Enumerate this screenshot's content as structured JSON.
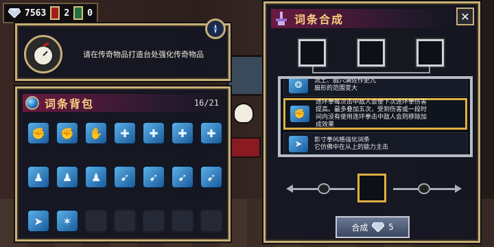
{
  "hud": {
    "gems": "7563",
    "red_cards": "2",
    "green_cards": "0"
  },
  "quest": {
    "text": "请在传奇物品打造台处强化传奇物品"
  },
  "bag": {
    "title": "词条背包",
    "count": "16/21",
    "slots": [
      {
        "icon": "bunny-fist-icon"
      },
      {
        "icon": "bunny-fist-icon"
      },
      {
        "icon": "gauntlet-icon"
      },
      {
        "icon": "fist-plus-icon"
      },
      {
        "icon": "fist-plus-icon"
      },
      {
        "icon": "fist-plus-icon"
      },
      {
        "icon": "fist-plus-icon"
      },
      {
        "icon": "figure-icon"
      },
      {
        "icon": "figure-icon"
      },
      {
        "icon": "figure-icon"
      },
      {
        "icon": "kick-icon"
      },
      {
        "icon": "kick-icon"
      },
      {
        "icon": "kick-icon"
      },
      {
        "icon": "kick-icon"
      },
      {
        "icon": "dash-icon"
      },
      {
        "icon": "break-icon"
      }
    ]
  },
  "synth": {
    "title": "词条合成",
    "affixes": [
      {
        "text": "流土、戲穴满佐作吏亢\n扇形的范围变大",
        "icon": "fan-icon"
      },
      {
        "text": "连环拳每次击中敌人会使下次连环拳伤害\n提高。最多叠加五次，受到伤害或一段时\n间内没有使用连环拳击中敌人会则移除加\n成效果",
        "icon": "bunny-fist-icon"
      },
      {
        "text": "影寸拳风格强化词条\n它仿佛中在从上的能力主击",
        "icon": "dash-icon"
      }
    ],
    "button_label": "合成",
    "cost": "5"
  },
  "colors": {
    "accent": "#e0b040",
    "frame": "#c8b07a",
    "header": "#6a1a40",
    "slot": "#2a7fc7"
  }
}
